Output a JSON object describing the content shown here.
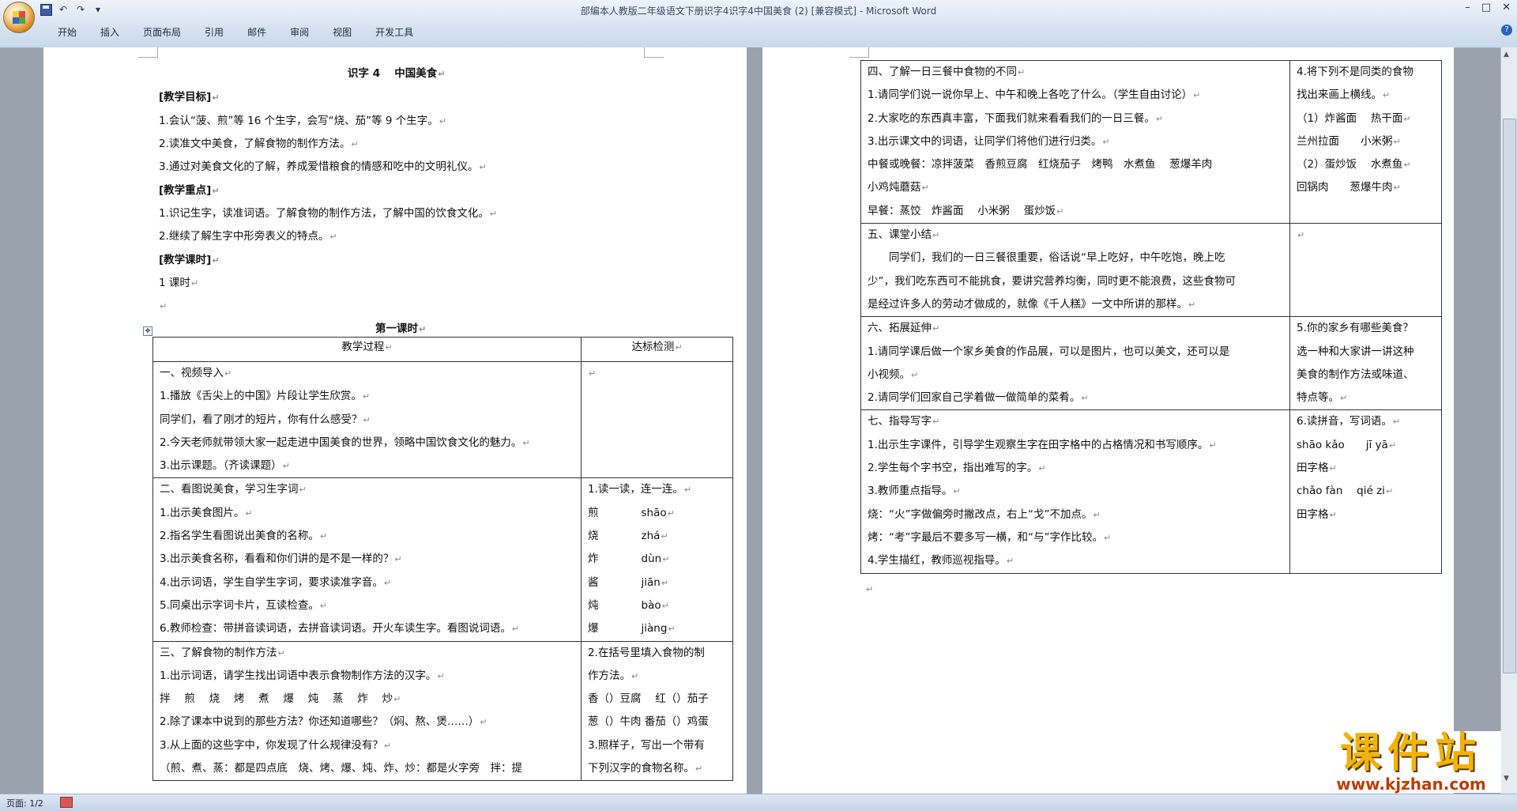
{
  "window": {
    "title": "部编本人教版二年级语文下册识字4识字4中国美食 (2) [兼容模式] - Microsoft Word",
    "tabs": [
      "开始",
      "插入",
      "页面布局",
      "引用",
      "邮件",
      "审阅",
      "视图",
      "开发工具"
    ]
  },
  "status": {
    "page": "页面: 1/2"
  },
  "watermark": {
    "main": "课件站",
    "url": "www.kjzhan.com"
  },
  "page1": {
    "title": "识字 4　 中国美食",
    "lines": [
      "[教学目标]",
      "1.会认“菠、煎”等 16 个生字，会写“烧、茄”等 9 个生字。",
      "2.读准文中美食，了解食物的制作方法。",
      "3.通过对美食文化的了解，养成爱惜粮食的情感和吃中的文明礼仪。",
      "[教学重点]",
      "1.识记生字，读准词语。了解食物的制作方法，了解中国的饮食文化。",
      "2.继续了解生字中形旁表义的特点。",
      "[教学课时]",
      "1 课时"
    ],
    "section_title": "第一课时",
    "table_headers": [
      "教学过程",
      "达标检测"
    ],
    "rows": [
      {
        "left": [
          "一、视频导入",
          "1.播放《舌尖上的中国》片段让学生欣赏。",
          "同学们，看了刚才的短片，你有什么感受？",
          "2.今天老师就带领大家一起走进中国美食的世界，领略中国饮食文化的魅力。",
          "3.出示课题。（齐读课题）"
        ],
        "right": [
          ""
        ]
      },
      {
        "left": [
          "二、看图说美食，学习生字词",
          "1.出示美食图片。",
          "2.指名学生看图说出美食的名称。",
          "3.出示美食名称，看看和你们讲的是不是一样的？",
          "4.出示词语，学生自学生字词，要求读准字音。",
          "5.同桌出示字词卡片，互读检查。",
          "6.教师检查：带拼音读词语，去拼音读词语。开火车读生字。看图说词语。"
        ],
        "right": [
          "1.读一读，连一连。",
          "煎　　　　shāo",
          "烧　　　　zhá",
          "炸　　　　dùn",
          "酱　　　　jiān",
          "炖　　　　bào",
          "爆　　　　jiàng"
        ]
      },
      {
        "left": [
          "三、了解食物的制作方法",
          "1.出示词语，请学生找出词语中表示食物制作方法的汉字。",
          "拌　 煎　 烧　 烤　 煮　 爆　 炖　 蒸　 炸　 炒",
          "2.除了课本中说到的那些方法？你还知道哪些？（焖、熬、煲……）",
          "3.从上面的这些字中，你发现了什么规律没有？",
          "（煎、煮、蒸：都是四点底　烧、烤、爆、炖、炸、炒：都是火字旁　拌：提"
        ],
        "right": [
          "2.在括号里填入食物的制",
          "作方法。",
          "香（）豆腐　 红（）茄子",
          "葱（）牛肉 番茄（）鸡蛋",
          "3.照样子，写出一个带有",
          "下列汉字的食物名称。"
        ]
      }
    ]
  },
  "page2": {
    "rows": [
      {
        "left": [
          "四、了解一日三餐中食物的不同",
          "1.请同学们说一说你早上、中午和晚上各吃了什么。（学生自由讨论）",
          "2.大家吃的东西真丰富，下面我们就来看看我们的一日三餐。",
          "3.出示课文中的词语，让同学们将他们进行归类。",
          "中餐或晚餐：凉拌菠菜　香煎豆腐　红烧茄子　烤鸭　水煮鱼　 葱爆羊肉",
          "小鸡炖蘑菇",
          "早餐：蒸饺　炸酱面　 小米粥　 蛋炒饭"
        ],
        "right": [
          "4.将下列不是同类的食物",
          "找出来画上横线。",
          "（1）炸酱面　 热干面",
          "兰州拉面　　小米粥",
          "（2）蛋炒饭　 水煮鱼",
          "回锅肉　　葱爆牛肉"
        ]
      },
      {
        "left": [
          "五、课堂小结",
          "　　同学们，我们的一日三餐很重要，俗话说“早上吃好，中午吃饱，晚上吃",
          "少”，我们吃东西可不能挑食，要讲究营养均衡，同时更不能浪费，这些食物可",
          "是经过许多人的劳动才做成的，就像《千人糕》一文中所讲的那样。"
        ],
        "right": [
          ""
        ]
      },
      {
        "left": [
          "六、拓展延伸",
          "1.请同学课后做一个家乡美食的作品展，可以是图片，也可以美文，还可以是",
          "小视频。",
          "2.请同学们回家自己学着做一做简单的菜肴。"
        ],
        "right": [
          "5.你的家乡有哪些美食？",
          "选一种和大家讲一讲这种",
          "美食的制作方法或味道、",
          "特点等。"
        ]
      },
      {
        "left": [
          "七、指导写字",
          "1.出示生字课件，引导学生观察生字在田字格中的占格情况和书写顺序。",
          "2.学生每个字书空，指出难写的字。",
          "3.教师重点指导。",
          "烧：“火”字做偏旁时撇改点，右上“戈”不加点。",
          "烤：“考”字最后不要多写一横，和“与”字作比较。",
          "4.学生描红，教师巡视指导。"
        ],
        "right": [
          "6.读拼音，写词语。",
          "shāo kǎo　　jī yā",
          "田字格",
          "chǎo fàn　 qié zi",
          "田字格"
        ]
      }
    ]
  }
}
